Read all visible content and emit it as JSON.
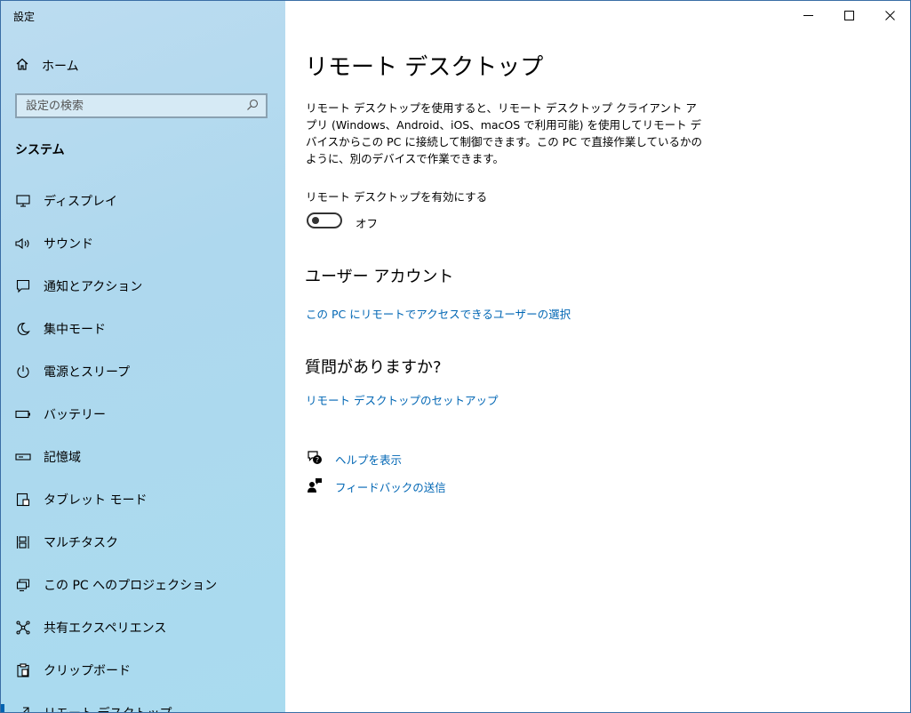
{
  "window": {
    "title": "設定",
    "controls": {
      "minimize": "—",
      "maximize": "☐",
      "close": "✕"
    }
  },
  "sidebar": {
    "home_label": "ホーム",
    "search_placeholder": "設定の検索",
    "section_title": "システム",
    "items": [
      {
        "label": "ディスプレイ",
        "icon": "monitor-icon"
      },
      {
        "label": "サウンド",
        "icon": "speaker-icon"
      },
      {
        "label": "通知とアクション",
        "icon": "notification-icon"
      },
      {
        "label": "集中モード",
        "icon": "moon-icon"
      },
      {
        "label": "電源とスリープ",
        "icon": "power-icon"
      },
      {
        "label": "バッテリー",
        "icon": "battery-icon"
      },
      {
        "label": "記憶域",
        "icon": "storage-icon"
      },
      {
        "label": "タブレット モード",
        "icon": "tablet-icon"
      },
      {
        "label": "マルチタスク",
        "icon": "multitask-icon"
      },
      {
        "label": "この PC へのプロジェクション",
        "icon": "projection-icon"
      },
      {
        "label": "共有エクスペリエンス",
        "icon": "share-icon"
      },
      {
        "label": "クリップボード",
        "icon": "clipboard-icon"
      },
      {
        "label": "リモート デスクトップ",
        "icon": "remote-icon"
      }
    ]
  },
  "main": {
    "title": "リモート デスクトップ",
    "description": "リモート デスクトップを使用すると、リモート デスクトップ クライアント アプリ (Windows、Android、iOS、macOS で利用可能) を使用してリモート デバイスからこの PC に接続して制御できます。この PC で直接作業しているかのように、別のデバイスで作業できます。",
    "toggle_label": "リモート デスクトップを有効にする",
    "toggle_state": "オフ",
    "user_accounts_heading": "ユーザー アカウント",
    "user_accounts_link": "この PC にリモートでアクセスできるユーザーの選択",
    "question_heading": "質問がありますか?",
    "setup_link": "リモート デスクトップのセットアップ",
    "help_link": "ヘルプを表示",
    "feedback_link": "フィードバックの送信"
  },
  "colors": {
    "accent": "#0063b1",
    "link": "#0066b4",
    "sidebar_bg": "#aed8ee"
  }
}
